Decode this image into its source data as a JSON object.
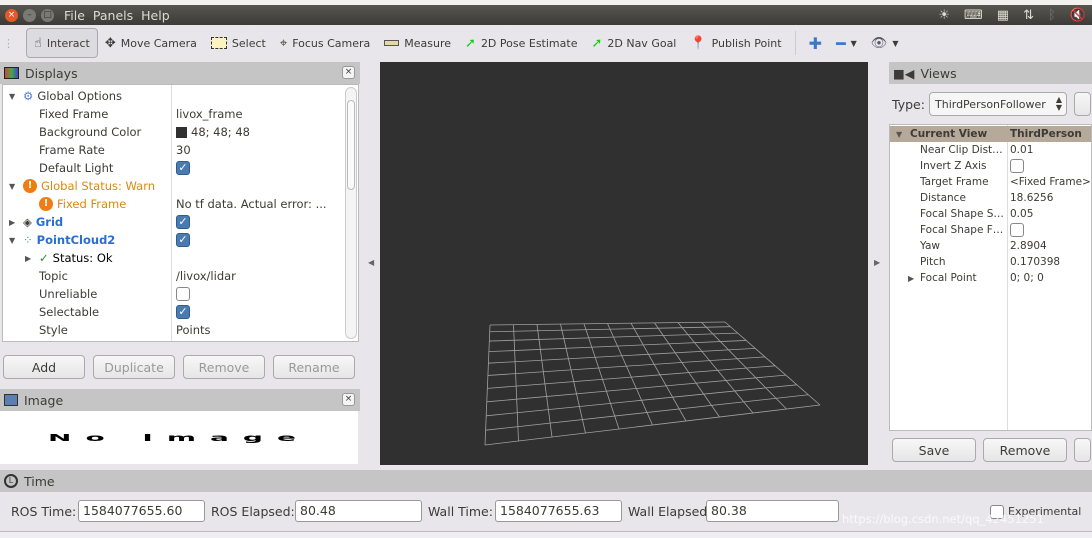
{
  "menubar": {
    "items": [
      "File",
      "Panels",
      "Help"
    ]
  },
  "toolbar": {
    "tools": [
      {
        "label": "Interact",
        "icon": "hand-icon",
        "active": true
      },
      {
        "label": "Move Camera",
        "icon": "move-camera-icon"
      },
      {
        "label": "Select",
        "icon": "select-icon"
      },
      {
        "label": "Focus Camera",
        "icon": "focus-camera-icon"
      },
      {
        "label": "Measure",
        "icon": "ruler-icon"
      },
      {
        "label": "2D Pose Estimate",
        "icon": "green-arrow-icon"
      },
      {
        "label": "2D Nav Goal",
        "icon": "green-arrow-icon"
      },
      {
        "label": "Publish Point",
        "icon": "map-pin-icon"
      }
    ]
  },
  "displays": {
    "title": "Displays",
    "global_options": "Global Options",
    "fixed_frame_label": "Fixed Frame",
    "fixed_frame": "livox_frame",
    "bg_label": "Background Color",
    "bg_value": "48; 48; 48",
    "bg_color": "#303030",
    "frame_rate_label": "Frame Rate",
    "frame_rate": "30",
    "default_light_label": "Default Light",
    "default_light": true,
    "global_status": "Global Status: Warn",
    "ff_warn_label": "Fixed Frame",
    "ff_warn_value": "No tf data.  Actual error: ...",
    "grid": "Grid",
    "grid_enabled": true,
    "pointcloud": "PointCloud2",
    "pointcloud_enabled": true,
    "status": "Status: Ok",
    "topic_label": "Topic",
    "topic": "/livox/lidar",
    "unreliable_label": "Unreliable",
    "unreliable": false,
    "selectable_label": "Selectable",
    "selectable": true,
    "style_label": "Style",
    "style": "Points",
    "buttons": {
      "add": "Add",
      "duplicate": "Duplicate",
      "remove": "Remove",
      "rename": "Rename"
    }
  },
  "image": {
    "title": "Image",
    "placeholder": "No Image"
  },
  "views": {
    "title": "Views",
    "type_label": "Type:",
    "type_value": "ThirdPersonFollower",
    "current_view": "Current View",
    "current_view_value": "ThirdPerson",
    "props": [
      {
        "k": "Near Clip Dist…",
        "v": "0.01"
      },
      {
        "k": "Invert Z Axis",
        "v": "",
        "check": false
      },
      {
        "k": "Target Frame",
        "v": "<Fixed Frame>"
      },
      {
        "k": "Distance",
        "v": "18.6256"
      },
      {
        "k": "Focal Shape S…",
        "v": "0.05"
      },
      {
        "k": "Focal Shape F…",
        "v": "",
        "check": false
      },
      {
        "k": "Yaw",
        "v": "2.8904"
      },
      {
        "k": "Pitch",
        "v": "0.170398"
      },
      {
        "k": "Focal Point",
        "v": "0; 0; 0"
      }
    ],
    "buttons": {
      "save": "Save",
      "remove": "Remove"
    }
  },
  "time": {
    "title": "Time",
    "ros_time_label": "ROS Time:",
    "ros_time": "1584077655.60",
    "ros_elapsed_label": "ROS Elapsed:",
    "ros_elapsed": "80.48",
    "wall_time_label": "Wall Time:",
    "wall_time": "1584077655.63",
    "wall_elapsed_label": "Wall Elapsed:",
    "wall_elapsed": "80.38",
    "experimental": "Experimental"
  },
  "watermark": "https://blog.csdn.net/qq_42451251",
  "viewport": {
    "background": "#303030",
    "grid_cells": 10
  }
}
